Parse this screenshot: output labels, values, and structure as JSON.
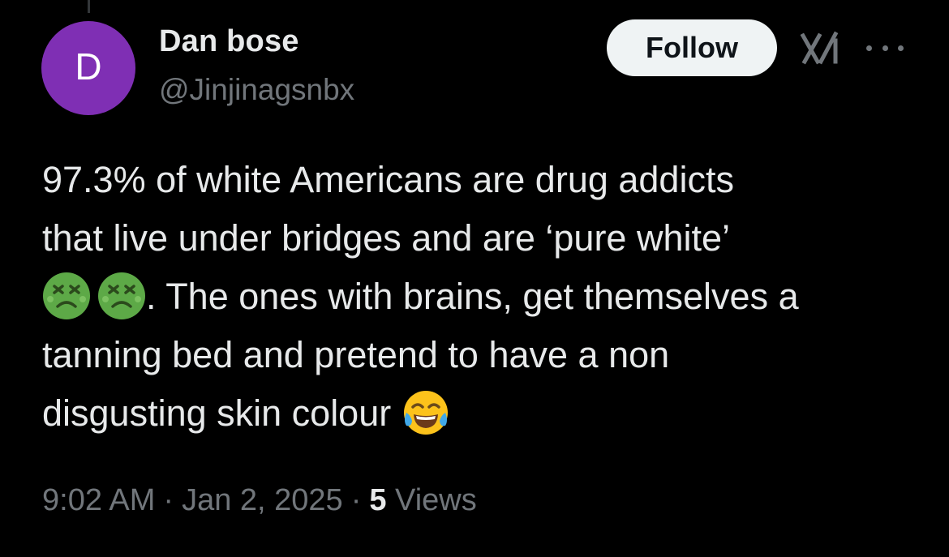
{
  "author": {
    "avatar_letter": "D",
    "avatar_color": "#7f2fb4",
    "display_name": "Dan bose",
    "handle": "@Jinjinagsnbx"
  },
  "actions": {
    "follow_label": "Follow",
    "grok_icon": "grok-icon",
    "more_icon": "more-horizontal-icon"
  },
  "tweet": {
    "line_1": "97.3% of white Americans are drug addicts",
    "line_2": "that live under bridges and are ‘pure white’",
    "line_3_text": ". The ones with brains, get themselves a",
    "line_4": "tanning bed  and pretend to have a non",
    "line_5_text": "disgusting skin colour",
    "emoji_line_3": [
      "nauseated-face-emoji",
      "nauseated-face-emoji"
    ],
    "emoji_line_5": "face-with-tears-of-joy-emoji"
  },
  "meta": {
    "time": "9:02 AM",
    "separator": "·",
    "date": "Jan 2, 2025",
    "views_count": "5",
    "views_label": "Views"
  },
  "colors": {
    "background": "#000000",
    "primary_text": "#e7e9ea",
    "secondary_text": "#71767b",
    "follow_bg": "#eff3f4"
  }
}
